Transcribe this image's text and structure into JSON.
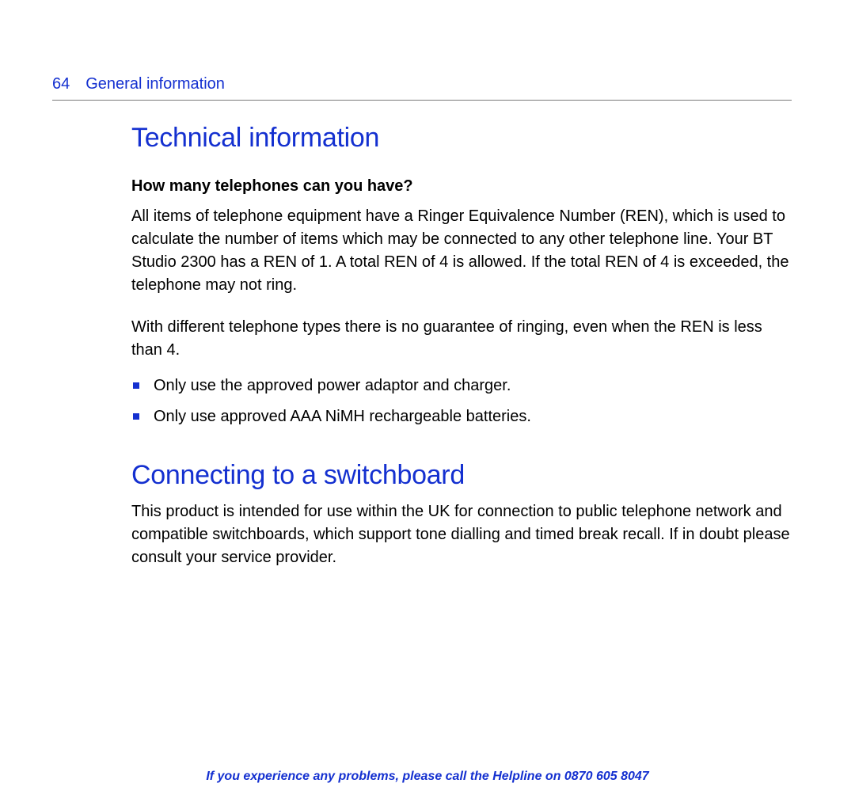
{
  "header": {
    "page_number": "64",
    "section_name": "General information"
  },
  "section1": {
    "title": "Technical information",
    "subheading": "How many telephones can you have?",
    "para1": "All items of telephone equipment have a Ringer Equivalence Number (REN), which is used to calculate the number of items which may be connected to any other telephone line. Your BT Studio 2300 has a REN of 1. A total REN of 4 is allowed. If the total REN of 4 is exceeded, the telephone may not ring.",
    "para2": "With different telephone types there is no guarantee of ringing, even when the REN is less than 4.",
    "bullets": [
      "Only use the approved power adaptor and charger.",
      "Only use approved AAA NiMH rechargeable batteries."
    ]
  },
  "section2": {
    "title": "Connecting to a switchboard",
    "para1": "This product is intended for use within the UK for connection to public telephone network and compatible switchboards, which support tone dialling and timed break recall. If in doubt please consult your service provider."
  },
  "footer": {
    "text_prefix": "If you experience any problems, please call the Helpline on ",
    "phone": "0870 605 8047"
  }
}
